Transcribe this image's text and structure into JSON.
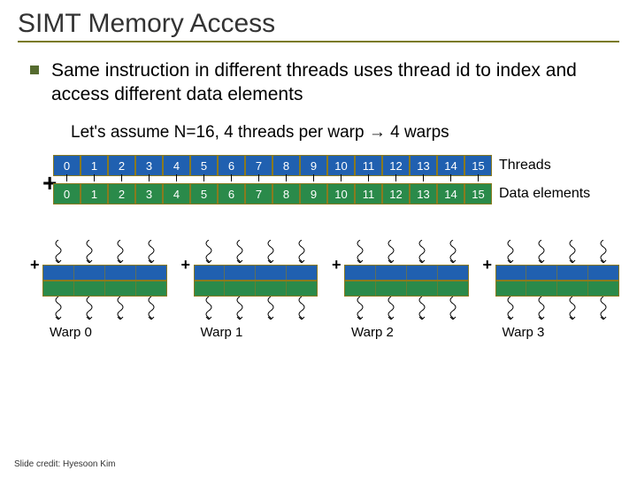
{
  "title": "SIMT Memory Access",
  "bullet": "Same instruction in different threads uses thread id to index and access different data elements",
  "assume": "Let's assume N=16, 4 threads per warp → 4 warps",
  "threads_label": "Threads",
  "data_label": "Data elements",
  "plus_big": "+",
  "plus_small": "+",
  "row0": [
    "0",
    "1",
    "2",
    "3",
    "4",
    "5",
    "6",
    "7",
    "8",
    "9",
    "10",
    "11",
    "12",
    "13",
    "14",
    "15"
  ],
  "row1": [
    "0",
    "1",
    "2",
    "3",
    "4",
    "5",
    "6",
    "7",
    "8",
    "9",
    "10",
    "11",
    "12",
    "13",
    "14",
    "15"
  ],
  "warps": [
    "Warp 0",
    "Warp 1",
    "Warp 2",
    "Warp 3"
  ],
  "credit": "Slide credit: Hyesoon Kim",
  "chart_data": {
    "type": "table",
    "title": "SIMT thread-to-data mapping",
    "N": 16,
    "threads_per_warp": 4,
    "num_warps": 4,
    "thread_ids": [
      0,
      1,
      2,
      3,
      4,
      5,
      6,
      7,
      8,
      9,
      10,
      11,
      12,
      13,
      14,
      15
    ],
    "data_indices": [
      0,
      1,
      2,
      3,
      4,
      5,
      6,
      7,
      8,
      9,
      10,
      11,
      12,
      13,
      14,
      15
    ],
    "warp_assignment": [
      0,
      0,
      0,
      0,
      1,
      1,
      1,
      1,
      2,
      2,
      2,
      2,
      3,
      3,
      3,
      3
    ]
  }
}
